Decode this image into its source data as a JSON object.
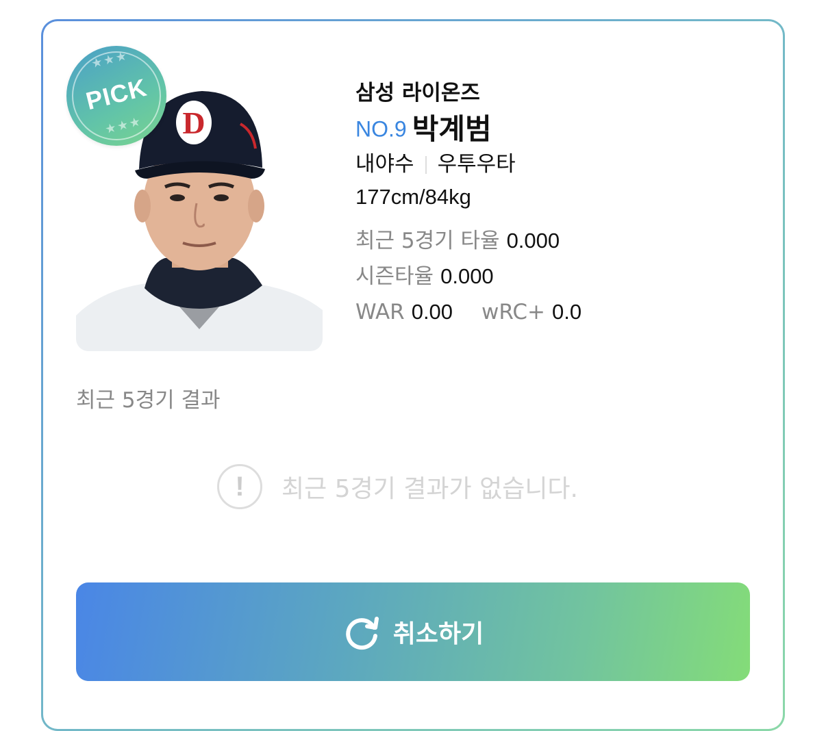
{
  "badge": {
    "label": "PICK",
    "stars": "★★★"
  },
  "player": {
    "team": "삼성 라이온즈",
    "number": "NO.9",
    "name": "박계범",
    "position": "내야수",
    "bat_throw": "우투우타",
    "body": "177cm/84kg",
    "photo_icon": "player-photo"
  },
  "stats": {
    "recent5_avg_label": "최근 5경기 타율",
    "recent5_avg_value": "0.000",
    "season_avg_label": "시즌타율",
    "season_avg_value": "0.000",
    "war_label": "WAR",
    "war_value": "0.00",
    "wrc_label": "wRC+",
    "wrc_value": "0.0"
  },
  "recent_results": {
    "title": "최근 5경기 결과",
    "empty_icon": "!",
    "empty_message": "최근 5경기 결과가 없습니다."
  },
  "action": {
    "cancel_label": "취소하기",
    "icon": "refresh-icon"
  },
  "colors": {
    "accent_blue": "#3a86e0",
    "gradient_start": "#4a86e6",
    "gradient_end": "#84dc78"
  }
}
